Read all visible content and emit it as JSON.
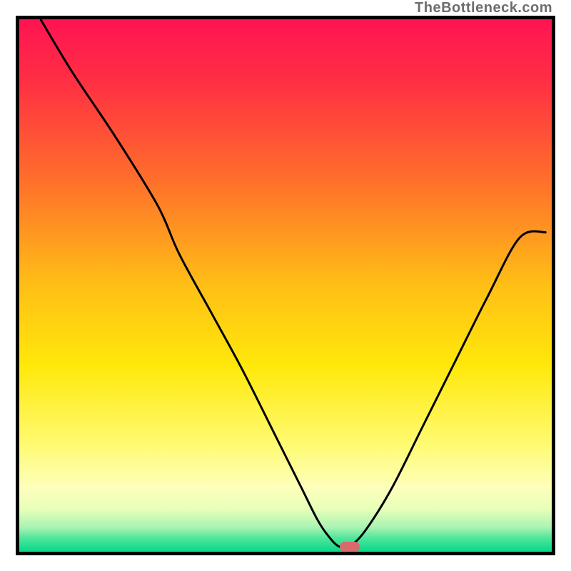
{
  "watermark": "TheBottleneck.com",
  "colors": {
    "frame": "#000000",
    "line": "#000000",
    "marker": "#d86a6c",
    "gradient_stops": [
      {
        "offset": 0.0,
        "color": "#ff1452"
      },
      {
        "offset": 0.12,
        "color": "#ff3043"
      },
      {
        "offset": 0.3,
        "color": "#ff6e2b"
      },
      {
        "offset": 0.5,
        "color": "#ffbf16"
      },
      {
        "offset": 0.65,
        "color": "#ffe80a"
      },
      {
        "offset": 0.8,
        "color": "#fffb73"
      },
      {
        "offset": 0.88,
        "color": "#fdffbb"
      },
      {
        "offset": 0.92,
        "color": "#e7ffb8"
      },
      {
        "offset": 0.955,
        "color": "#a7f3b3"
      },
      {
        "offset": 0.975,
        "color": "#4de59a"
      },
      {
        "offset": 1.0,
        "color": "#06d989"
      }
    ]
  },
  "chart_data": {
    "type": "line",
    "title": "",
    "xlabel": "",
    "ylabel": "",
    "xlim": [
      0,
      100
    ],
    "ylim": [
      0,
      100
    ],
    "note": "Values estimated from pixel positions; x is horizontal percent, y is vertical percent (0 at bottom).",
    "series": [
      {
        "name": "curve",
        "x": [
          4,
          10,
          18,
          26,
          30,
          36,
          42,
          48,
          53,
          56,
          58,
          60,
          62,
          65,
          70,
          76,
          82,
          88,
          94,
          99
        ],
        "y": [
          100,
          90,
          78,
          65,
          56,
          45,
          34,
          22,
          12,
          6,
          3,
          1,
          1,
          4,
          12,
          24,
          36,
          48,
          59,
          60
        ]
      }
    ],
    "marker": {
      "x": 62,
      "y": 1
    }
  }
}
